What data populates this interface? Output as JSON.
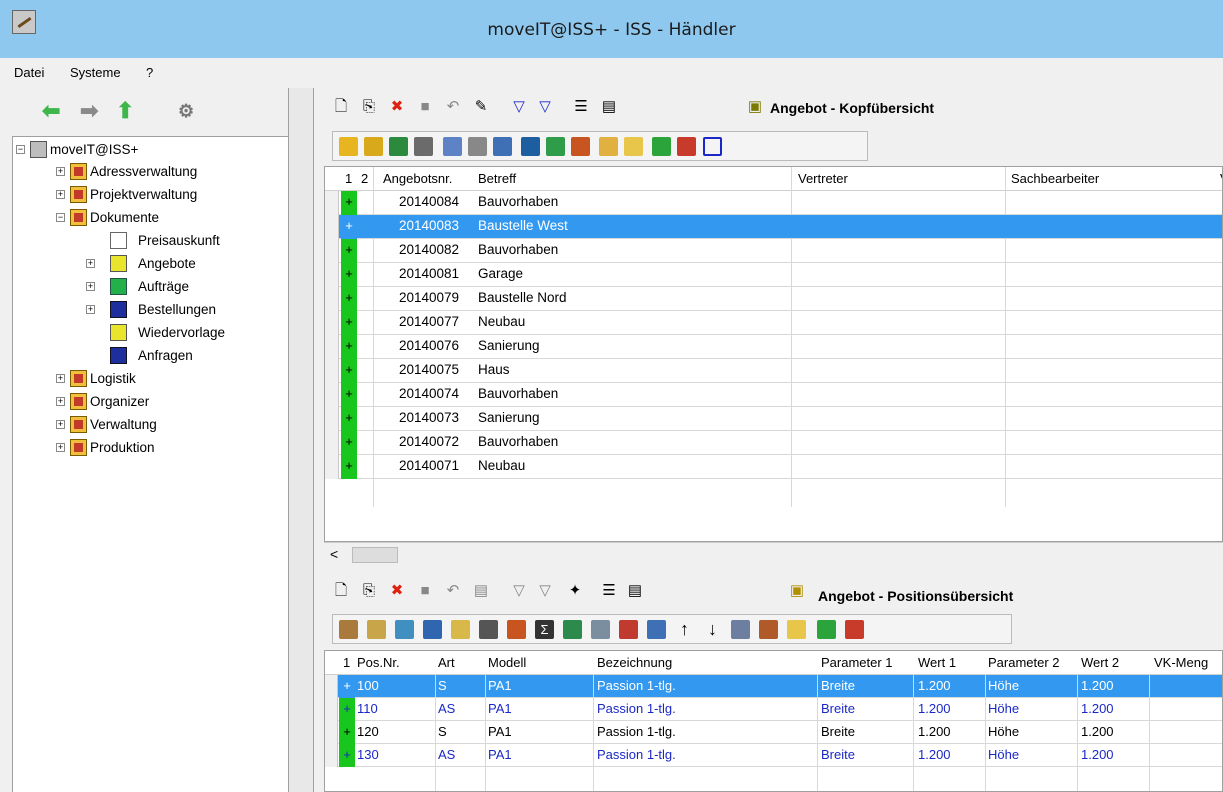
{
  "window": {
    "title": "moveIT@ISS+ - ISS - Händler"
  },
  "menu": {
    "items": [
      "Datei",
      "Systeme",
      "?"
    ]
  },
  "tree": {
    "root": "moveIT@ISS+",
    "nodes": [
      {
        "label": "Adressverwaltung",
        "icon": "drawer-icon"
      },
      {
        "label": "Projektverwaltung",
        "icon": "drawer-icon"
      },
      {
        "label": "Dokumente",
        "icon": "drawer-icon"
      },
      {
        "label": "Preisauskunft",
        "icon": "document-white-icon"
      },
      {
        "label": "Angebote",
        "icon": "document-yellow-icon"
      },
      {
        "label": "Aufträge",
        "icon": "document-green-icon"
      },
      {
        "label": "Bestellungen",
        "icon": "document-blue-icon"
      },
      {
        "label": "Wiedervorlage",
        "icon": "document-yellow-icon"
      },
      {
        "label": "Anfragen",
        "icon": "document-blue-icon"
      },
      {
        "label": "Logistik",
        "icon": "drawer-icon"
      },
      {
        "label": "Organizer",
        "icon": "drawer-icon"
      },
      {
        "label": "Verwaltung",
        "icon": "drawer-icon"
      },
      {
        "label": "Produktion",
        "icon": "drawer-icon"
      }
    ]
  },
  "header_panel": {
    "title": "Angebot - Kopfübersicht",
    "columns": [
      "1",
      "2",
      "Angebotsnr.",
      "Betreff",
      "Vertreter",
      "Sachbearbeiter",
      "V"
    ],
    "rows": [
      {
        "nr": "20140084",
        "betreff": "Bauvorhaben"
      },
      {
        "nr": "20140083",
        "betreff": "Baustelle West",
        "selected": true
      },
      {
        "nr": "20140082",
        "betreff": "Bauvorhaben"
      },
      {
        "nr": "20140081",
        "betreff": "Garage"
      },
      {
        "nr": "20140079",
        "betreff": "Baustelle Nord"
      },
      {
        "nr": "20140077",
        "betreff": "Neubau"
      },
      {
        "nr": "20140076",
        "betreff": "Sanierung"
      },
      {
        "nr": "20140075",
        "betreff": "Haus"
      },
      {
        "nr": "20140074",
        "betreff": "Bauvorhaben"
      },
      {
        "nr": "20140073",
        "betreff": "Sanierung"
      },
      {
        "nr": "20140072",
        "betreff": "Bauvorhaben"
      },
      {
        "nr": "20140071",
        "betreff": "Neubau"
      }
    ],
    "plus": "+"
  },
  "position_panel": {
    "title": "Angebot - Positionsübersicht",
    "columns": [
      "1",
      "Pos.Nr.",
      "Art",
      "Modell",
      "Bezeichnung",
      "Parameter 1",
      "Wert 1",
      "Parameter 2",
      "Wert 2",
      "VK-Meng"
    ],
    "rows": [
      {
        "pos": "100",
        "art": "S",
        "modell": "PA1",
        "bez": "Passion 1-tlg.",
        "p1": "Breite",
        "w1": "1.200",
        "p2": "Höhe",
        "w2": "1.200",
        "selected": true
      },
      {
        "pos": "110",
        "art": "AS",
        "modell": "PA1",
        "bez": "Passion 1-tlg.",
        "p1": "Breite",
        "w1": "1.200",
        "p2": "Höhe",
        "w2": "1.200",
        "blue": true
      },
      {
        "pos": "120",
        "art": "S",
        "modell": "PA1",
        "bez": "Passion 1-tlg.",
        "p1": "Breite",
        "w1": "1.200",
        "p2": "Höhe",
        "w2": "1.200"
      },
      {
        "pos": "130",
        "art": "AS",
        "modell": "PA1",
        "bez": "Passion 1-tlg.",
        "p1": "Breite",
        "w1": "1.200",
        "p2": "Höhe",
        "w2": "1.200",
        "blue": true
      }
    ]
  },
  "colors": {
    "selection": "#3399f0",
    "plus_green": "#19c61d",
    "titlebar": "#8ec8ee",
    "link_blue": "#1b28c8"
  }
}
